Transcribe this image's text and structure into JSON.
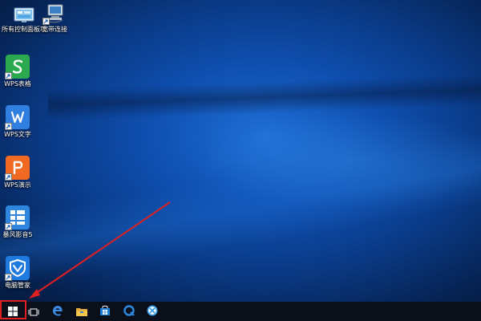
{
  "desktop": {
    "icons": [
      {
        "label": "所有控制面板项",
        "icon": "control-panel-icon"
      },
      {
        "label": "宽带连接",
        "icon": "broadband-connection-icon"
      },
      {
        "label": "WPS表格",
        "icon": "wps-spreadsheet-icon",
        "color": "#2aa94f"
      },
      {
        "label": "WPS文字",
        "icon": "wps-writer-icon",
        "color": "#2f7fe0"
      },
      {
        "label": "WPS演示",
        "icon": "wps-presentation-icon",
        "color": "#f06a24"
      },
      {
        "label": "暴风影音5",
        "icon": "baofeng-player-icon",
        "color": "#2e86de"
      },
      {
        "label": "电脑管家",
        "icon": "pc-manager-icon",
        "color": "#1f7ae0"
      }
    ]
  },
  "taskbar": {
    "items": [
      {
        "icon": "windows-start-icon"
      },
      {
        "icon": "task-view-icon"
      },
      {
        "icon": "edge-browser-icon",
        "color": "#3a8ee6"
      },
      {
        "icon": "file-explorer-icon",
        "color": "#f3c64b"
      },
      {
        "icon": "store-icon",
        "color": "#1e7fd6"
      },
      {
        "icon": "browser-icon",
        "color": "#2a8be0"
      },
      {
        "icon": "app-x-icon",
        "color": "#3a9ee8"
      }
    ]
  },
  "annotation": {
    "highlight_color": "#e02020",
    "target": "windows-start-button"
  }
}
